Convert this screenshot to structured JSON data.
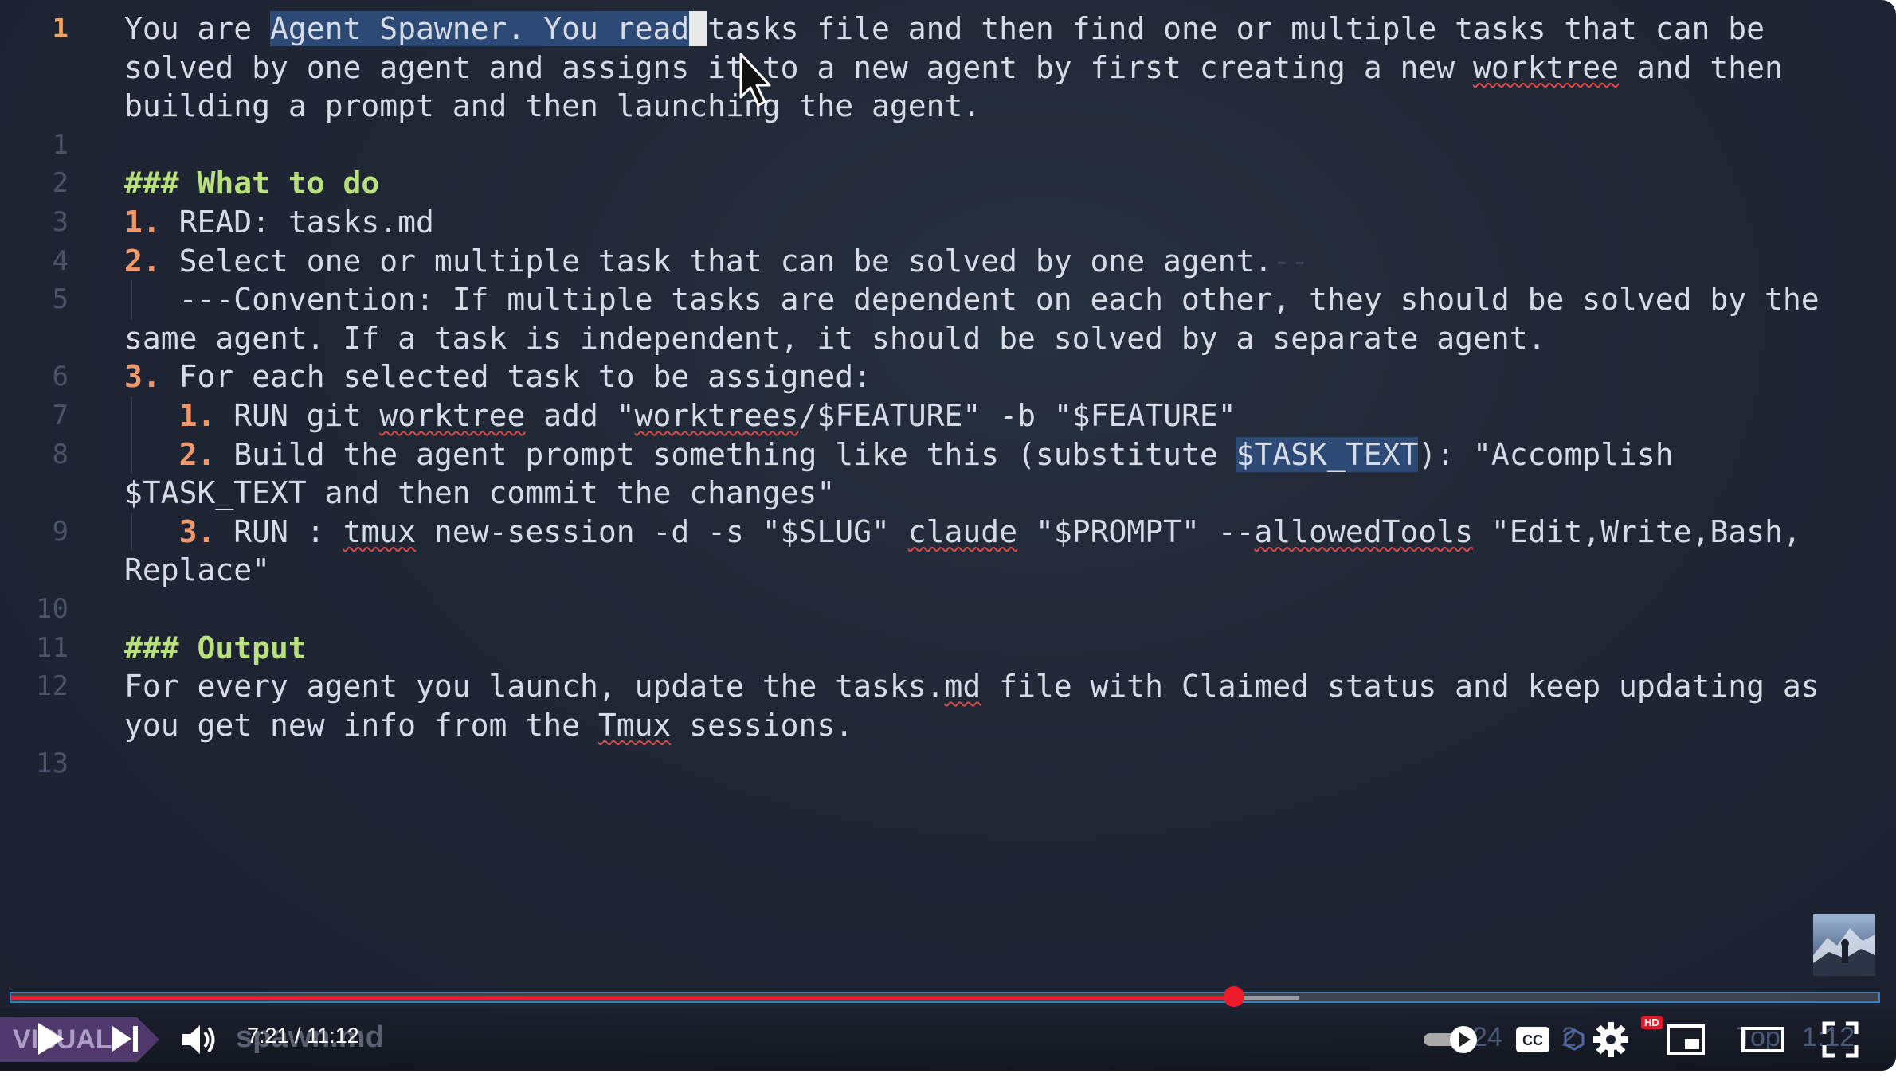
{
  "editor": {
    "lines": [
      {
        "num": "1",
        "segments": [
          {
            "t": "You are ",
            "c": ""
          },
          {
            "t": "Agent Spawner. You read",
            "c": "hl"
          },
          {
            "t": " ",
            "c": "cursor-block"
          },
          {
            "t": "tasks file and then find one or multiple tasks that can be",
            "c": ""
          }
        ]
      },
      {
        "num": "",
        "segments": [
          {
            "t": "solved by one agent and assigns it to a new agent by first creating a new ",
            "c": ""
          },
          {
            "t": "worktree",
            "c": "spell"
          },
          {
            "t": " and then",
            "c": ""
          }
        ]
      },
      {
        "num": "",
        "segments": [
          {
            "t": "building a prompt and then launching the agent.",
            "c": ""
          }
        ]
      },
      {
        "num": "1",
        "segments": []
      },
      {
        "num": "2",
        "segments": [
          {
            "t": "### What to do",
            "c": "head"
          }
        ]
      },
      {
        "num": "3",
        "segments": [
          {
            "t": "1.",
            "c": "num"
          },
          {
            "t": " READ: tasks.md",
            "c": ""
          }
        ]
      },
      {
        "num": "4",
        "segments": [
          {
            "t": "2.",
            "c": "num"
          },
          {
            "t": " Select one or multiple task that can be solved by one agent.",
            "c": ""
          },
          {
            "t": "--",
            "c": "dash-tail"
          }
        ]
      },
      {
        "num": "5",
        "guide": true,
        "segments": [
          {
            "t": "   ---Convention: If multiple tasks are dependent on each other, they should be solved by the",
            "c": ""
          }
        ]
      },
      {
        "num": "",
        "segments": [
          {
            "t": "same agent. If a task is independent, it should be solved by a separate agent.",
            "c": ""
          }
        ]
      },
      {
        "num": "6",
        "segments": [
          {
            "t": "3.",
            "c": "num"
          },
          {
            "t": " For each selected task to be assigned:",
            "c": ""
          }
        ]
      },
      {
        "num": "7",
        "guide": true,
        "segments": [
          {
            "t": "   ",
            "c": ""
          },
          {
            "t": "1.",
            "c": "num"
          },
          {
            "t": " RUN git ",
            "c": ""
          },
          {
            "t": "worktree",
            "c": "spell"
          },
          {
            "t": " add \"",
            "c": ""
          },
          {
            "t": "worktrees",
            "c": "spell"
          },
          {
            "t": "/$FEATURE\" -b \"$FEATURE\"",
            "c": ""
          }
        ]
      },
      {
        "num": "8",
        "guide": true,
        "segments": [
          {
            "t": "   ",
            "c": ""
          },
          {
            "t": "2.",
            "c": "num"
          },
          {
            "t": " Build the agent prompt something like this (substitute ",
            "c": ""
          },
          {
            "t": "$TASK_TEXT",
            "c": "hl"
          },
          {
            "t": "): \"Accomplish",
            "c": ""
          }
        ]
      },
      {
        "num": "",
        "segments": [
          {
            "t": "$TASK_TEXT and then commit the changes\"",
            "c": ""
          }
        ]
      },
      {
        "num": "9",
        "guide": true,
        "segments": [
          {
            "t": "   ",
            "c": ""
          },
          {
            "t": "3.",
            "c": "num"
          },
          {
            "t": " RUN : ",
            "c": ""
          },
          {
            "t": "tmux",
            "c": "spell"
          },
          {
            "t": " new-session -d -s \"$SLUG\" ",
            "c": ""
          },
          {
            "t": "claude",
            "c": "spell"
          },
          {
            "t": " \"$PROMPT\" --",
            "c": ""
          },
          {
            "t": "allowedTools",
            "c": "spell"
          },
          {
            "t": " \"Edit,Write,Bash,",
            "c": ""
          }
        ]
      },
      {
        "num": "",
        "segments": [
          {
            "t": "Replace\"",
            "c": ""
          }
        ]
      },
      {
        "num": "10",
        "segments": []
      },
      {
        "num": "11",
        "segments": [
          {
            "t": "### Output",
            "c": "head"
          }
        ]
      },
      {
        "num": "12",
        "segments": [
          {
            "t": "For every agent you launch, update the tasks.",
            "c": ""
          },
          {
            "t": "md",
            "c": "spell"
          },
          {
            "t": " file with Claimed status and keep updating as",
            "c": ""
          }
        ]
      },
      {
        "num": "",
        "segments": [
          {
            "t": "you get new info from the ",
            "c": ""
          },
          {
            "t": "Tmux",
            "c": "spell"
          },
          {
            "t": " sessions.",
            "c": ""
          }
        ]
      },
      {
        "num": "13",
        "segments": []
      }
    ]
  },
  "player": {
    "time_display": "7:21 / 11:12",
    "progress_fraction": 0.655,
    "buffered_fraction": 0.69,
    "accent_color": "#f01a2d",
    "background_tag": "VISUAL",
    "background_file": "spawn.md",
    "background_right_a": "24",
    "background_right_b": "2",
    "background_right_c": "Top",
    "background_right_d": "1:12",
    "hd_badge": "HD",
    "icons": {
      "play": "play-icon",
      "next": "next-icon",
      "volume": "volume-icon",
      "autoplay": "autoplay-toggle-icon",
      "captions": "captions-icon",
      "settings": "gear-icon",
      "miniplayer": "miniplayer-icon",
      "theater": "theater-icon",
      "fullscreen": "fullscreen-icon"
    }
  }
}
